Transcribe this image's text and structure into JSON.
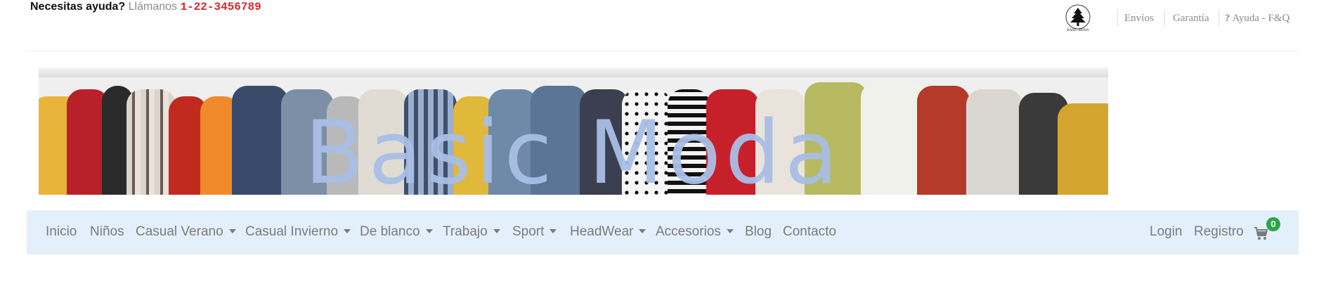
{
  "topbar": {
    "help_question": "Necesitas ayuda?",
    "call_label": "Llámanos",
    "phone": "1-22-3456789",
    "logo_caption": "BASIC MODA",
    "links": [
      {
        "label": "Envíos"
      },
      {
        "label": "Garantía"
      },
      {
        "label": "Ayuda - F&Q"
      }
    ],
    "help_icon_glyph": "?"
  },
  "banner": {
    "title": "Basic Moda"
  },
  "nav": {
    "items": [
      {
        "label": "Inicio",
        "dropdown": false
      },
      {
        "label": "Niños",
        "dropdown": false
      },
      {
        "label": "Casual Verano",
        "dropdown": true
      },
      {
        "label": "Casual Invierno",
        "dropdown": true
      },
      {
        "label": "De blanco",
        "dropdown": true
      },
      {
        "label": "Trabajo",
        "dropdown": true
      },
      {
        "label": "Sport",
        "dropdown": true
      },
      {
        "label": "HeadWear",
        "dropdown": true
      },
      {
        "label": "Accesorios",
        "dropdown": true
      },
      {
        "label": "Blog",
        "dropdown": false
      },
      {
        "label": "Contacto",
        "dropdown": false
      }
    ],
    "login": "Login",
    "register": "Registro",
    "cart_count": "0"
  },
  "colors": {
    "phone": "#d9252a",
    "nav_background": "#e3f0fb",
    "cart_badge": "#28a745",
    "banner_title": "#a9bfe6"
  },
  "icons": {
    "cart": "shopping-cart-icon",
    "help": "question-icon",
    "logo": "tree-logo-icon"
  }
}
